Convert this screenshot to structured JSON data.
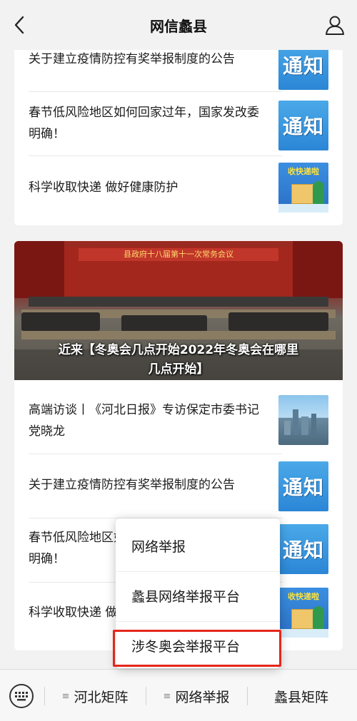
{
  "header": {
    "title": "网信蠡县",
    "back_icon": "chevron-left-icon",
    "user_icon": "user-icon"
  },
  "card1": {
    "items": [
      {
        "title": "关于建立疫情防控有奖举报制度的公告",
        "thumb": "通知"
      },
      {
        "title": "春节低风险地区如何回家过年，国家发改委明确！",
        "thumb": "通知"
      },
      {
        "title": "科学收取快递 做好健康防护",
        "thumb": "收快递啦"
      }
    ]
  },
  "banner": {
    "stage_title": "县政府十八届第十一次常务会议",
    "caption": "近来【冬奥会几点开始2022年冬奥会在哪里几点开始】"
  },
  "card2": {
    "items": [
      {
        "title": "高端访谈丨《河北日报》专访保定市委书记党晓龙"
      },
      {
        "title": "关于建立疫情防控有奖举报制度的公告",
        "thumb": "通知"
      },
      {
        "title": "春节低风险地区如何回家过年，国家发改委明确！",
        "thumb": "通知"
      },
      {
        "title": "科学收取快递 做好健康防护",
        "thumb": "收快递啦"
      }
    ]
  },
  "popup": {
    "options": [
      "网络举报",
      "蠡县网络举报平台",
      "涉冬奥会举报平台"
    ]
  },
  "bottombar": {
    "keyboard_icon": "keyboard-icon",
    "menus": [
      "河北矩阵",
      "网络举报",
      "蠡县矩阵"
    ]
  },
  "colors": {
    "notice_blue": "#2b86d6",
    "highlight_red": "#e4271b",
    "background": "#f2f2f2"
  }
}
